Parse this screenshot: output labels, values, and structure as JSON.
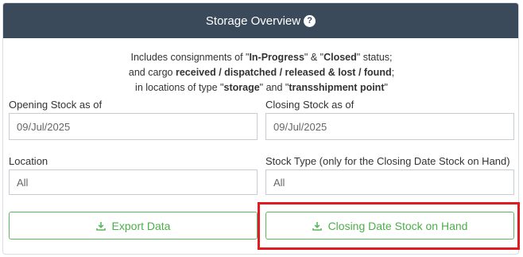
{
  "header": {
    "title": "Storage Overview",
    "help_glyph": "?"
  },
  "info": {
    "line1_pre": "Includes consignments of \"",
    "line1_b1": "In-Progress",
    "line1_mid": "\" & \"",
    "line1_b2": "Closed",
    "line1_post": "\" status;",
    "line2_pre": "and cargo ",
    "line2_b": "received / dispatched / released & lost / found",
    "line2_post": ";",
    "line3_pre": "in locations of type \"",
    "line3_b1": "storage",
    "line3_mid": "\" and \"",
    "line3_b2": "transshipment point",
    "line3_post": "\""
  },
  "fields": {
    "opening_label": "Opening Stock as of",
    "opening_value": "09/Jul/2025",
    "closing_label": "Closing Stock as of",
    "closing_value": "09/Jul/2025",
    "location_label": "Location",
    "location_value": "All",
    "stock_type_label": "Stock Type (only for the Closing Date Stock on Hand)",
    "stock_type_value": "All"
  },
  "buttons": {
    "export_label": "Export Data",
    "closing_stock_label": "Closing Date Stock on Hand"
  },
  "colors": {
    "header_bg": "#3b4a5b",
    "button_green": "#5cb85c",
    "highlight_red": "#e11b22"
  }
}
